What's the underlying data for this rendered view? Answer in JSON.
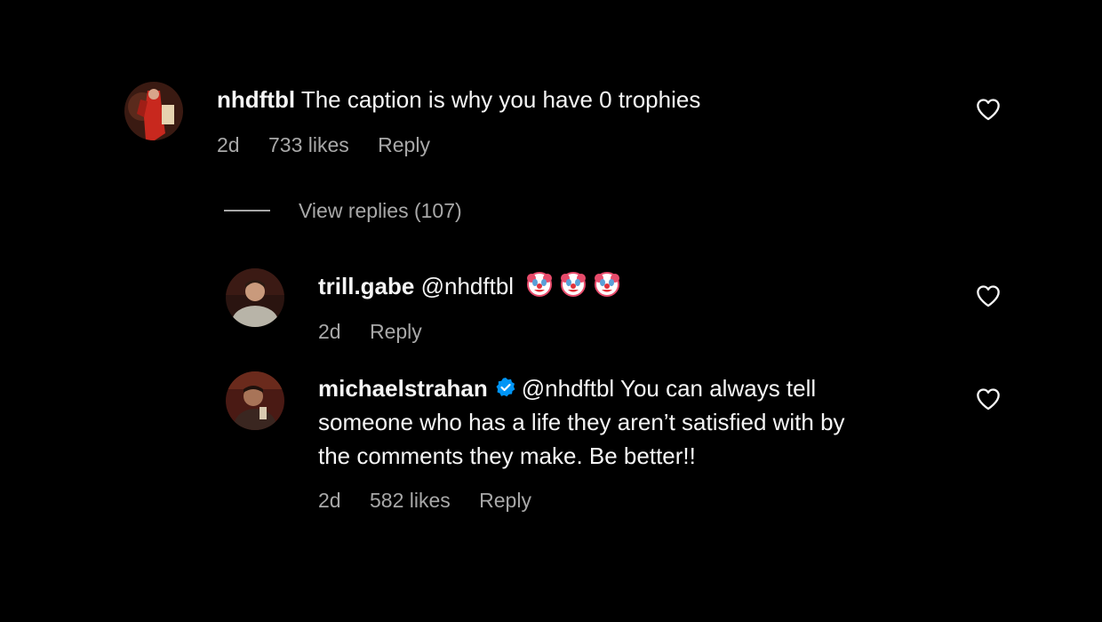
{
  "comments": [
    {
      "username": "nhdftbl",
      "text": "The caption is why you have 0 trophies",
      "time": "2d",
      "likes": "733 likes",
      "reply_label": "Reply",
      "view_replies": "View replies (107)"
    }
  ],
  "replies": [
    {
      "username": "trill.gabe",
      "mention": "@nhdftbl",
      "emoji_icons": [
        "clown-face-icon",
        "clown-face-icon",
        "clown-face-icon"
      ],
      "time": "2d",
      "reply_label": "Reply"
    },
    {
      "username": "michaelstrahan",
      "verified": true,
      "mention": "@nhdftbl",
      "text_line1": "You can always tell",
      "text_line2": "someone who has a life they aren’t satisfied with by",
      "text_line3": "the comments they make. Be better!!",
      "time": "2d",
      "likes": "582 likes",
      "reply_label": "Reply"
    }
  ],
  "icons": {
    "like": "heart-outline-icon",
    "verified": "verified-badge-icon"
  },
  "colors": {
    "background": "#000000",
    "primary_text": "#f5f5f5",
    "secondary_text": "#a8a8a8",
    "verified_blue": "#0095f6"
  }
}
